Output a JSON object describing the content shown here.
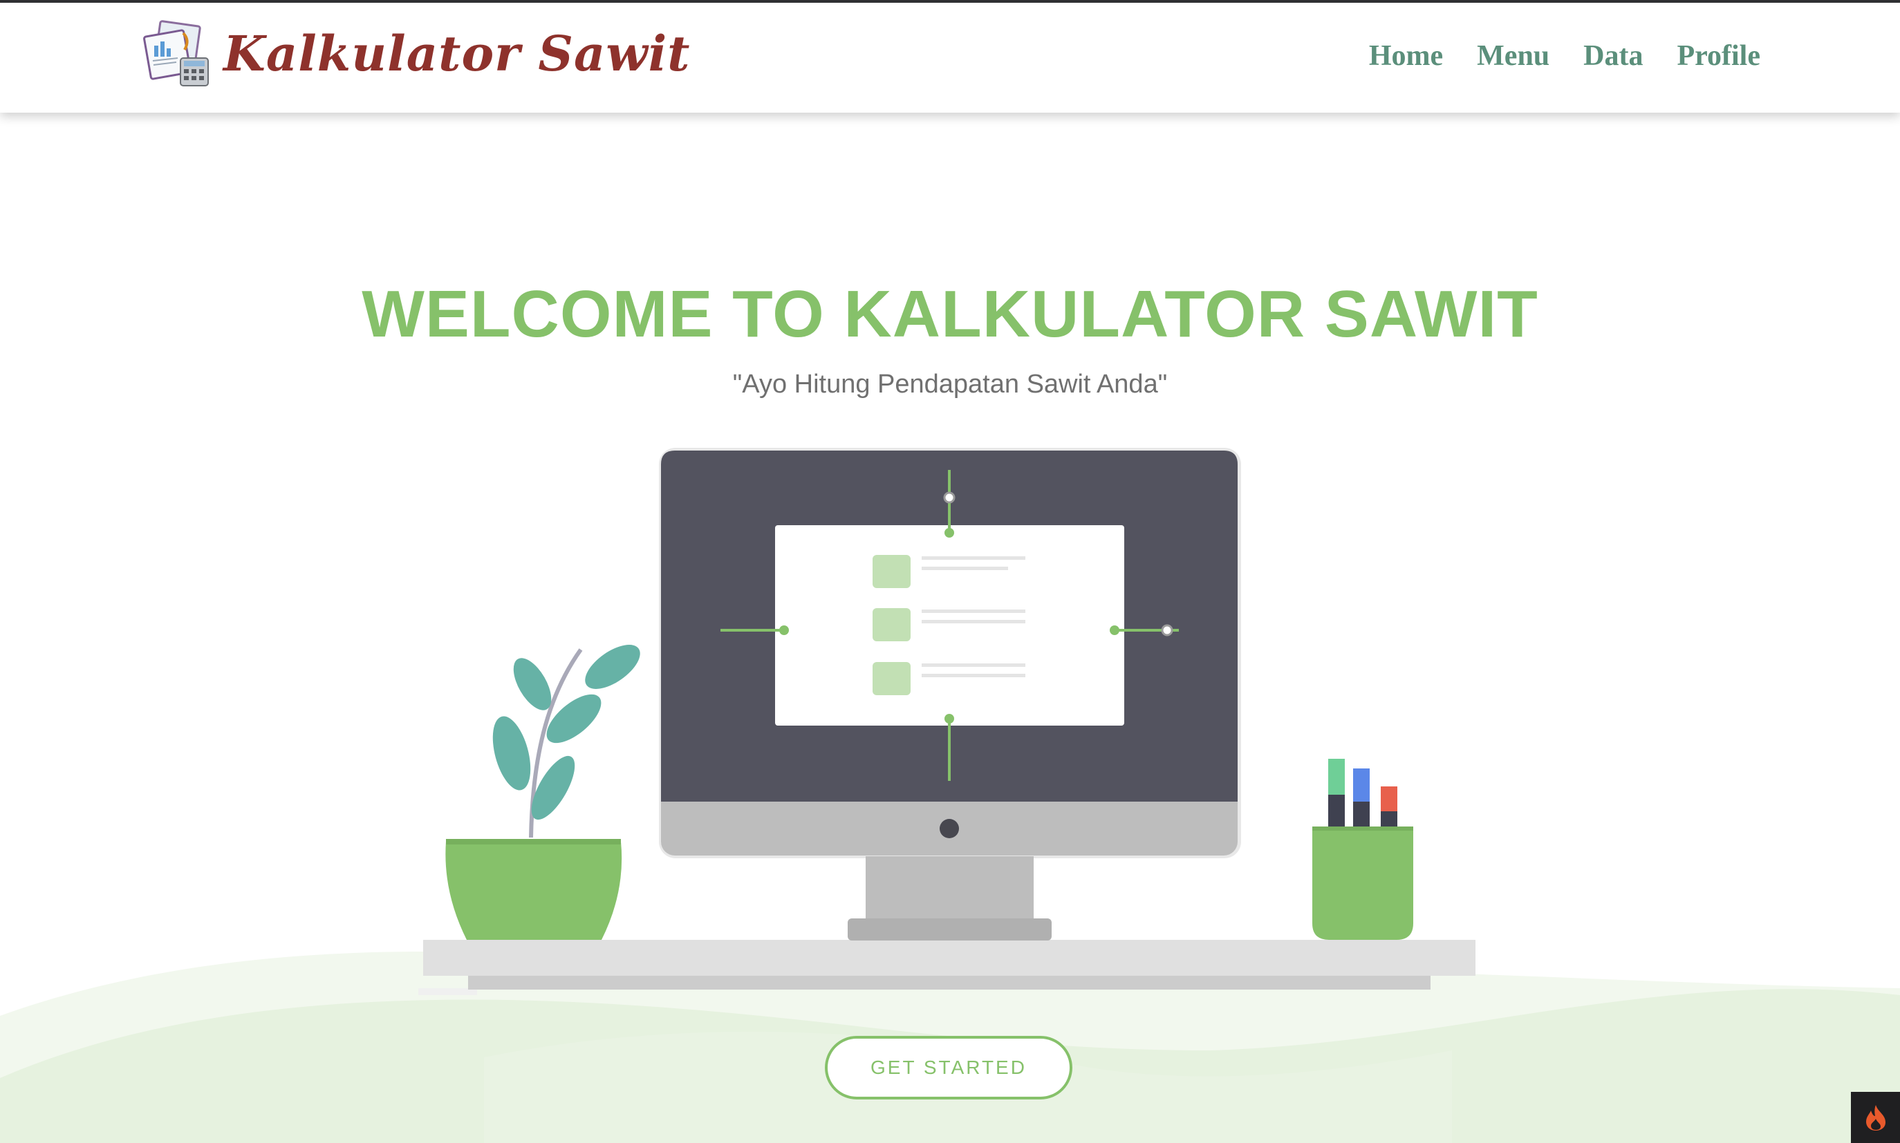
{
  "navbar": {
    "brand": {
      "name": "Kalkulator Sawit",
      "logo_icon": "calculator-documents-icon"
    },
    "links": [
      {
        "label": "Home"
      },
      {
        "label": "Menu"
      },
      {
        "label": "Data"
      },
      {
        "label": "Profile"
      }
    ]
  },
  "hero": {
    "title": "WELCOME TO KALKULATOR SAWIT",
    "subtitle": "\"Ayo Hitung Pendapatan Sawit Anda\"",
    "illustration": "desktop-workspace-illustration",
    "cta_label": "GET STARTED"
  },
  "corner_badge": {
    "icon": "flame-icon"
  },
  "colors": {
    "brand_text": "#8e322c",
    "nav_link": "#5b8f7b",
    "accent_green": "#86c16a",
    "subtitle_gray": "#707070",
    "monitor_screen": "#53535f",
    "hills_light": "#f2f8ee",
    "hills_mid": "#e6f2df"
  }
}
